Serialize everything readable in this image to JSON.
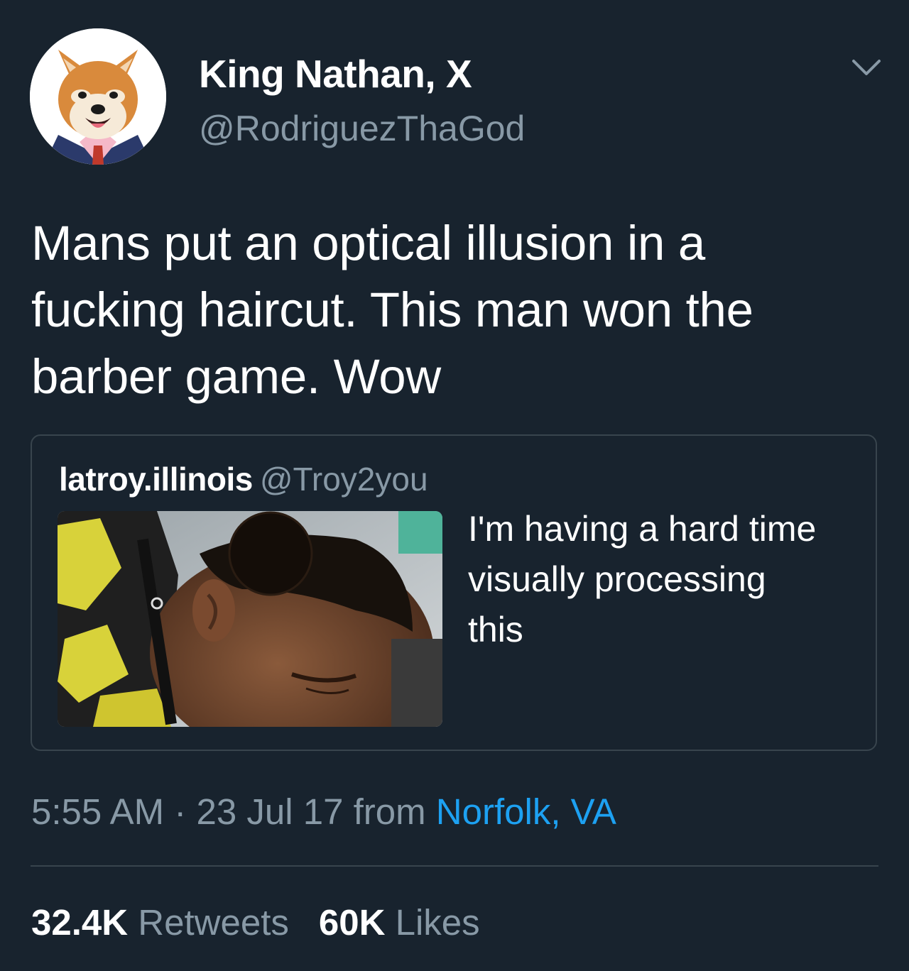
{
  "tweet": {
    "display_name": "King Nathan, X",
    "handle": "@RodriguezThaGod",
    "text": "Mans put an optical illusion in a\nfucking haircut. This man won the\nbarber game. Wow",
    "avatar_icon": "shiba-dog-in-suit-avatar",
    "menu_icon": "chevron-down-icon"
  },
  "quoted_tweet": {
    "display_name": "latroy.illinois",
    "handle": "@Troy2you",
    "text": "I'm having a hard time\nvisually processing\nthis",
    "image_icon": "haircut-photo"
  },
  "meta": {
    "time": "5:55 AM",
    "separator": "·",
    "date": "23 Jul 17",
    "from_label": "from",
    "location": "Norfolk, VA"
  },
  "stats": {
    "retweets_count": "32.4K",
    "retweets_label": "Retweets",
    "likes_count": "60K",
    "likes_label": "Likes"
  },
  "colors": {
    "background": "#18232e",
    "secondary_text": "#8899a6",
    "link": "#1da1f2",
    "border": "#38444d"
  }
}
